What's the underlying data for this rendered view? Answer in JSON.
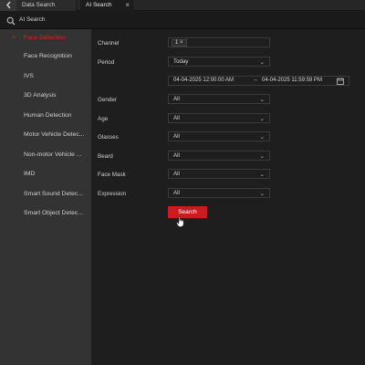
{
  "tabs": {
    "back_icon": "chevron-left-icon",
    "items": [
      {
        "label": "Data Search",
        "closable": false
      },
      {
        "label": "AI Search",
        "closable": true,
        "close_glyph": "×"
      }
    ]
  },
  "subheader": {
    "icon": "ai-search-icon",
    "title": "AI Search"
  },
  "sidebar": {
    "items": [
      {
        "label": "Face Detection",
        "active": true,
        "marker": ">"
      },
      {
        "label": "Face Recognition",
        "active": false
      },
      {
        "label": "IVS",
        "active": false
      },
      {
        "label": "3D Analysis",
        "active": false
      },
      {
        "label": "Human Detection",
        "active": false
      },
      {
        "label": "Motor Vehicle Detec...",
        "active": false
      },
      {
        "label": "Non-motor Vehicle ...",
        "active": false
      },
      {
        "label": "IMD",
        "active": false
      },
      {
        "label": "Smart Sound Detec...",
        "active": false
      },
      {
        "label": "Smart Object Detec...",
        "active": false
      }
    ]
  },
  "form": {
    "channel": {
      "label": "Channel",
      "value": "1",
      "remove_glyph": "×"
    },
    "period": {
      "label": "Period",
      "value": "Today",
      "chevron": "⌄"
    },
    "date_range": {
      "start": "04-04-2025 12:00:00 AM",
      "separator": "→",
      "end": "04-04-2025 11:59:59 PM",
      "icon": "calendar-icon"
    },
    "filters": [
      {
        "label": "Gender",
        "value": "All"
      },
      {
        "label": "Age",
        "value": "All"
      },
      {
        "label": "Glasses",
        "value": "All"
      },
      {
        "label": "Beard",
        "value": "All"
      },
      {
        "label": "Face Mask",
        "value": "All"
      },
      {
        "label": "Expression",
        "value": "All"
      }
    ],
    "search_label": "Search"
  },
  "colors": {
    "accent": "#c91d1d",
    "active_text": "#d9261c",
    "sidebar_bg": "#333333",
    "main_bg": "#1e1e1e"
  }
}
